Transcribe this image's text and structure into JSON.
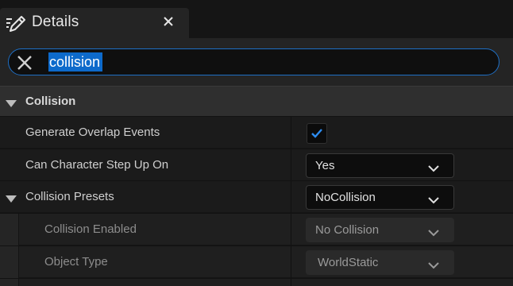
{
  "tab": {
    "title": "Details",
    "icon": "pencil-details-icon",
    "close_icon": "close-icon"
  },
  "search": {
    "query": "collision",
    "clear_icon": "clear-x-icon",
    "focus_color": "#1e6fc5"
  },
  "category": {
    "label": "Collision",
    "expanded": true
  },
  "properties": [
    {
      "label": "Generate Overlap Events",
      "type": "checkbox",
      "checked": true
    },
    {
      "label": "Can Character Step Up On",
      "type": "combo",
      "value": "Yes"
    },
    {
      "label": "Collision Presets",
      "type": "combo",
      "value": "NoCollision",
      "expandable": true,
      "expanded": true
    },
    {
      "label": "Collision Enabled",
      "type": "combo",
      "value": "No Collision",
      "child": true,
      "disabled": true
    },
    {
      "label": "Object Type",
      "type": "combo",
      "value": "WorldStatic",
      "child": true,
      "disabled": true
    }
  ],
  "colors": {
    "accent": "#0d6acb",
    "check": "#2d8cf0"
  }
}
